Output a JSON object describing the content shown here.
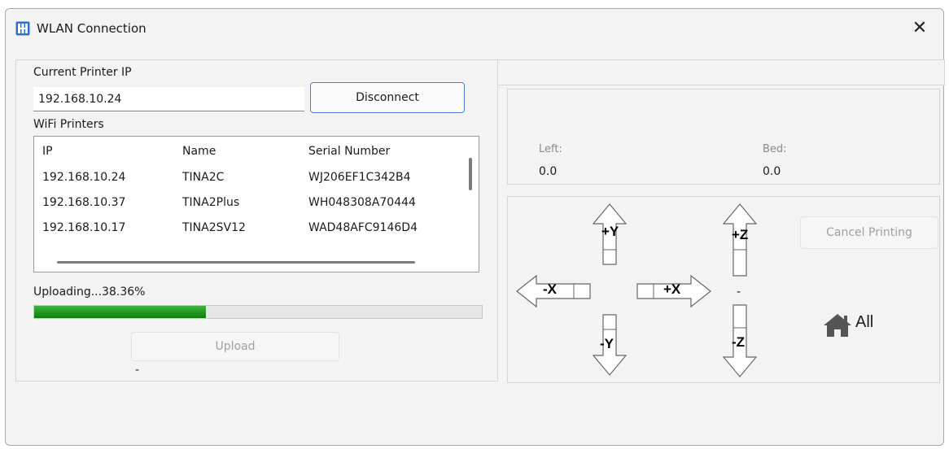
{
  "window": {
    "title": "WLAN Connection",
    "close_glyph": "✕"
  },
  "printer": {
    "ip_label": "Current Printer IP",
    "ip_value": "192.168.10.24",
    "disconnect_label": "Disconnect"
  },
  "wifi": {
    "label": "WiFi Printers",
    "columns": [
      "IP",
      "Name",
      "Serial Number"
    ],
    "rows": [
      [
        "192.168.10.24",
        "TINA2C",
        "WJ206EF1C342B4"
      ],
      [
        "192.168.10.37",
        "TINA2Plus",
        "WH048308A70444"
      ],
      [
        "192.168.10.17",
        "TINA2SV12",
        "WAD48AFC9146D4"
      ]
    ]
  },
  "upload": {
    "status": "Uploading...38.36%",
    "progress": 0.3836,
    "button_label": "Upload",
    "footer_dash": "-"
  },
  "temps": {
    "left_label": "Left:",
    "left_value": "0.0",
    "bed_label": "Bed:",
    "bed_value": "0.0"
  },
  "controls": {
    "cancel_label": "Cancel Printing",
    "plus_y": "+Y",
    "minus_y": "-Y",
    "plus_x": "+X",
    "minus_x": "-X",
    "plus_z": "+Z",
    "minus_z": "-Z",
    "z_dash": "-",
    "home_label": "All"
  },
  "colors": {
    "progress": "#1f9a1f",
    "accent_border": "#4a78c9"
  },
  "icons": {
    "app": "printer-grid-icon",
    "home": "home-icon",
    "close": "close-icon"
  }
}
